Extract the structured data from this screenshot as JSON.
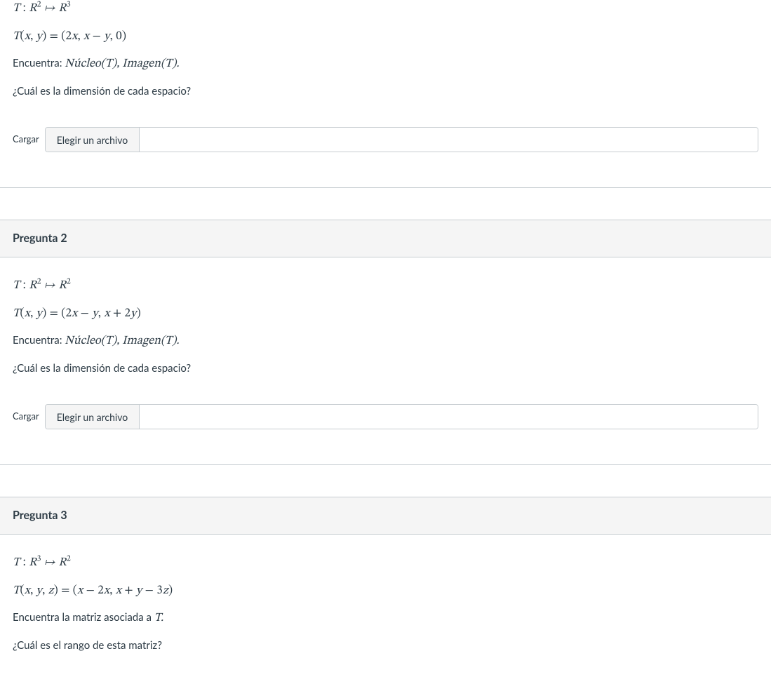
{
  "q1": {
    "line1_html": "<span class='mi'>T</span>&nbsp;<span class='rm'>:</span>&nbsp;<span class='mi'>R</span><sup>2</sup>&nbsp;↦&nbsp;<span class='mi'>R</span><sup>3</sup>",
    "line2_html": "<span class='mi'>T</span><span class='rm'>(</span><span class='mi'>x</span><span class='rm'>,</span>&nbsp;<span class='mi'>y</span><span class='rm'>)</span>&nbsp;<span class='rm'>=</span>&nbsp;<span class='rm'>(2</span><span class='mi'>x</span><span class='rm'>,</span>&nbsp;<span class='mi'>x</span>&nbsp;<span class='rm'>−</span>&nbsp;<span class='mi'>y</span><span class='rm'>,</span>&nbsp;<span class='rm'>0)</span>",
    "line3_prefix": "Encuentra: ",
    "line3_math": "<span class='mi'>N</span><span class='rm'>ú</span><span class='mi'>cleo</span><span class='rm'>(</span><span class='mi'>T</span><span class='rm'>)</span><span class='rm'>,</span>&nbsp;<span class='mi'>Imagen</span><span class='rm'>(</span><span class='mi'>T</span><span class='rm'>)</span><span class='rm'>.</span>",
    "line4": "¿Cuál es la dimensión de cada espacio?",
    "upload_label": "Cargar",
    "file_btn": "Elegir un archivo"
  },
  "q2": {
    "header": "Pregunta 2",
    "line1_html": "<span class='mi'>T</span>&nbsp;<span class='rm'>:</span>&nbsp;<span class='mi'>R</span><sup>2</sup>&nbsp;↦&nbsp;<span class='mi'>R</span><sup>2</sup>",
    "line2_html": "<span class='mi'>T</span><span class='rm'>(</span><span class='mi'>x</span><span class='rm'>,</span>&nbsp;<span class='mi'>y</span><span class='rm'>)</span>&nbsp;<span class='rm'>=</span>&nbsp;<span class='rm'>(2</span><span class='mi'>x</span>&nbsp;<span class='rm'>−</span>&nbsp;<span class='mi'>y</span><span class='rm'>,</span>&nbsp;<span class='mi'>x</span>&nbsp;<span class='rm'>+</span>&nbsp;<span class='rm'>2</span><span class='mi'>y</span><span class='rm'>)</span>",
    "line3_prefix": "Encuentra: ",
    "line3_math": "<span class='mi'>N</span><span class='rm'>ú</span><span class='mi'>cleo</span><span class='rm'>(</span><span class='mi'>T</span><span class='rm'>)</span><span class='rm'>,</span>&nbsp;<span class='mi'>Imagen</span><span class='rm'>(</span><span class='mi'>T</span><span class='rm'>)</span><span class='rm'>.</span>",
    "line4": "¿Cuál es la dimensión de cada espacio?",
    "upload_label": "Cargar",
    "file_btn": "Elegir un archivo"
  },
  "q3": {
    "header": "Pregunta 3",
    "line1_html": "<span class='mi'>T</span>&nbsp;<span class='rm'>:</span>&nbsp;<span class='mi'>R</span><sup>3</sup>&nbsp;↦&nbsp;<span class='mi'>R</span><sup>2</sup>",
    "line2_html": "<span class='mi'>T</span><span class='rm'>(</span><span class='mi'>x</span><span class='rm'>,</span>&nbsp;<span class='mi'>y</span><span class='rm'>,</span>&nbsp;<span class='mi'>z</span><span class='rm'>)</span>&nbsp;<span class='rm'>=</span>&nbsp;<span class='rm'>(</span><span class='mi'>x</span>&nbsp;<span class='rm'>−</span>&nbsp;<span class='rm'>2</span><span class='mi'>x</span><span class='rm'>,</span>&nbsp;<span class='mi'>x</span>&nbsp;<span class='rm'>+</span>&nbsp;<span class='mi'>y</span>&nbsp;<span class='rm'>−</span>&nbsp;<span class='rm'>3</span><span class='mi'>z</span><span class='rm'>)</span>",
    "line3_prefix": "Encuentra la matriz asociada a ",
    "line3_math": "<span class='mi'>T</span><span class='rm'>.</span>",
    "line4": "¿Cuál es el rango de esta matriz?"
  }
}
